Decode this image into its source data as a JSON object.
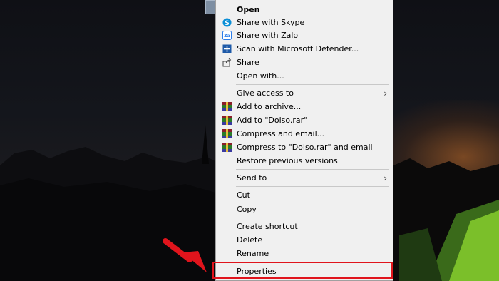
{
  "menu": {
    "items": [
      {
        "label": "Open",
        "icon": "none",
        "bold": true,
        "arrow": false
      },
      {
        "label": "Share with Skype",
        "icon": "skype-icon",
        "bold": false,
        "arrow": false
      },
      {
        "label": "Share with Zalo",
        "icon": "zalo-icon",
        "bold": false,
        "arrow": false
      },
      {
        "label": "Scan with Microsoft Defender...",
        "icon": "defender-icon",
        "bold": false,
        "arrow": false
      },
      {
        "label": "Share",
        "icon": "share-icon",
        "bold": false,
        "arrow": false
      },
      {
        "label": "Open with...",
        "icon": "none",
        "bold": false,
        "arrow": false
      },
      {
        "label": "Give access to",
        "icon": "none",
        "bold": false,
        "arrow": true
      },
      {
        "label": "Add to archive...",
        "icon": "winrar-icon",
        "bold": false,
        "arrow": false
      },
      {
        "label": "Add to \"Doiso.rar\"",
        "icon": "winrar-icon",
        "bold": false,
        "arrow": false
      },
      {
        "label": "Compress and email...",
        "icon": "winrar-icon",
        "bold": false,
        "arrow": false
      },
      {
        "label": "Compress to \"Doiso.rar\" and email",
        "icon": "winrar-icon",
        "bold": false,
        "arrow": false
      },
      {
        "label": "Restore previous versions",
        "icon": "none",
        "bold": false,
        "arrow": false
      },
      {
        "label": "Send to",
        "icon": "none",
        "bold": false,
        "arrow": true
      },
      {
        "label": "Cut",
        "icon": "none",
        "bold": false,
        "arrow": false
      },
      {
        "label": "Copy",
        "icon": "none",
        "bold": false,
        "arrow": false
      },
      {
        "label": "Create shortcut",
        "icon": "none",
        "bold": false,
        "arrow": false
      },
      {
        "label": "Delete",
        "icon": "none",
        "bold": false,
        "arrow": false
      },
      {
        "label": "Rename",
        "icon": "none",
        "bold": false,
        "arrow": false
      },
      {
        "label": "Properties",
        "icon": "none",
        "bold": false,
        "arrow": false,
        "highlighted": true
      }
    ],
    "submenu_arrow": "›"
  },
  "colors": {
    "menu_bg": "#f0f0f0",
    "highlight_border": "#e0141c",
    "arrow_red": "#e0141c"
  }
}
